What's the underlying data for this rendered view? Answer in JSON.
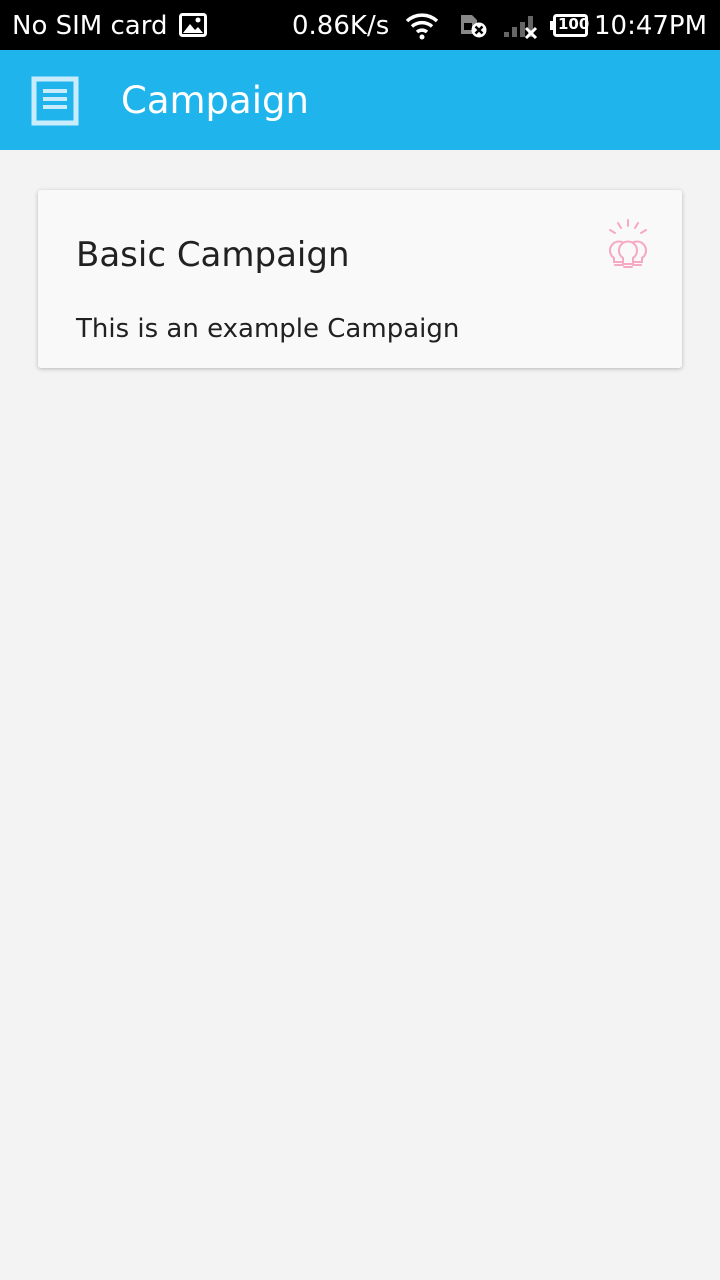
{
  "status_bar": {
    "carrier": "No SIM card",
    "speed": "0.86K/s",
    "battery": "100",
    "time": "10:47PM",
    "icons": [
      "image-icon",
      "wifi-icon",
      "sim-error-icon",
      "signal-none-icon",
      "battery-icon"
    ]
  },
  "app_bar": {
    "title": "Campaign",
    "menu_icon": "menu-icon",
    "background": "#1fb5ec"
  },
  "campaigns": [
    {
      "title": "Basic Campaign",
      "description": "This is an example Campaign",
      "icon": "lightbulbs-icon",
      "icon_color": "#f7a8c4"
    }
  ]
}
